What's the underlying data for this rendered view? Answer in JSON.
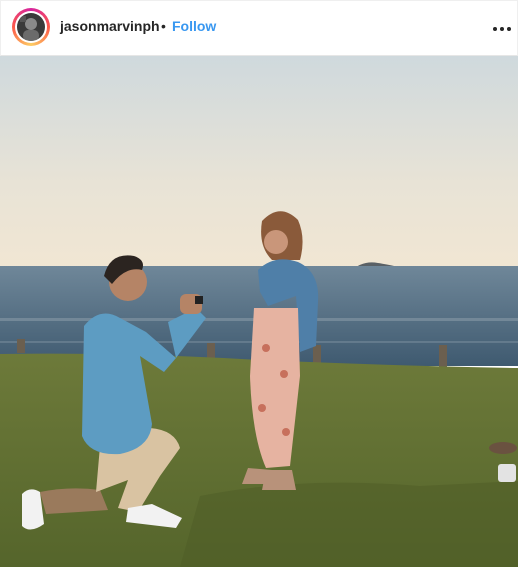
{
  "post": {
    "username": "jasonmarvinph",
    "separator": "•",
    "follow_label": "Follow"
  },
  "icons": {
    "avatar": "profile-avatar",
    "more": "more-options-icon"
  },
  "colors": {
    "follow": "#3897f0",
    "text": "#262626",
    "story_ring": "#d6249f"
  }
}
